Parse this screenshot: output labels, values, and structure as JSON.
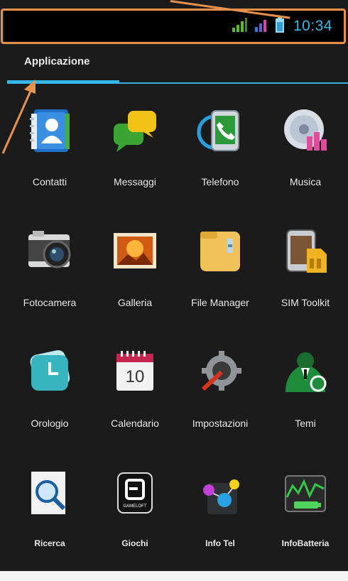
{
  "status_bar": {
    "time": "10:34",
    "icons": [
      "signal-icon",
      "data-activity-icon",
      "battery-icon"
    ]
  },
  "tab": {
    "label": "Applicazione"
  },
  "accent": "#33b5e5",
  "annotation_color": "#e8914a",
  "apps": [
    {
      "label": "Contatti",
      "icon": "contacts-icon"
    },
    {
      "label": "Messaggi",
      "icon": "messages-icon"
    },
    {
      "label": "Telefono",
      "icon": "phone-icon"
    },
    {
      "label": "Musica",
      "icon": "music-icon"
    },
    {
      "label": "Fotocamera",
      "icon": "camera-icon"
    },
    {
      "label": "Galleria",
      "icon": "gallery-icon"
    },
    {
      "label": "File Manager",
      "icon": "folder-icon"
    },
    {
      "label": "SIM Toolkit",
      "icon": "sim-icon"
    },
    {
      "label": "Orologio",
      "icon": "clock-icon"
    },
    {
      "label": "Calendario",
      "icon": "calendar-icon",
      "day": "10"
    },
    {
      "label": "Impostazioni",
      "icon": "settings-gear-icon"
    },
    {
      "label": "Temi",
      "icon": "themes-icon"
    },
    {
      "label": "Ricerca",
      "icon": "search-icon"
    },
    {
      "label": "Giochi",
      "icon": "games-icon",
      "brand": "GAMELOFT"
    },
    {
      "label": "Info Tel",
      "icon": "info-tel-icon"
    },
    {
      "label": "InfoBatteria",
      "icon": "battery-info-icon"
    }
  ]
}
